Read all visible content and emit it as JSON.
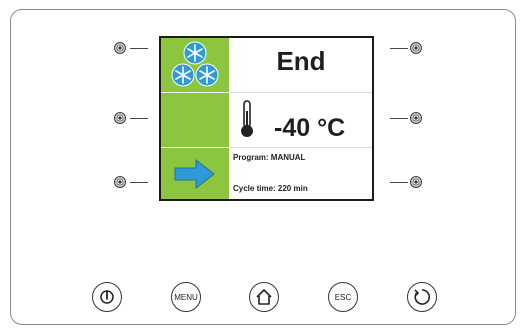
{
  "display": {
    "status": "End",
    "temperature": "-40 °C",
    "program": "Program: MANUAL",
    "cycle_time": "Cycle time: 220 min"
  },
  "icons": {
    "freeze": "snowflakes-icon",
    "thermometer": "thermometer-icon",
    "next": "arrow-right-icon"
  },
  "buttons": {
    "power": "power-icon",
    "menu": "MENU",
    "home": "home-icon",
    "esc": "ESC",
    "refresh": "refresh-icon"
  },
  "colors": {
    "accent_green": "#8cc63f",
    "icon_blue": "#2e9ad6"
  }
}
